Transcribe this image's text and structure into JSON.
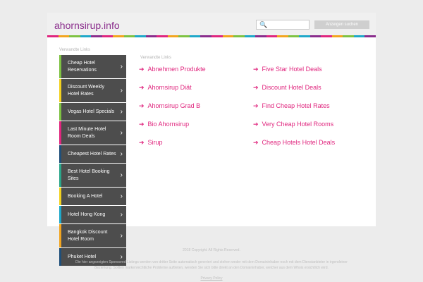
{
  "header": {
    "site_title": "ahornsirup.info",
    "search_placeholder": "",
    "search_button": "Anzeigen suchen"
  },
  "stripe_colors": [
    "#e0267e",
    "#f2a51f",
    "#7ec242",
    "#1fa8c9",
    "#8a2d8c",
    "#e0267e",
    "#f2a51f",
    "#7ec242",
    "#1fa8c9",
    "#8a2d8c",
    "#e0267e",
    "#f2a51f",
    "#7ec242",
    "#1fa8c9",
    "#8a2d8c",
    "#e0267e",
    "#f2a51f",
    "#7ec242",
    "#1fa8c9",
    "#8a2d8c",
    "#e0267e",
    "#f2a51f",
    "#7ec242",
    "#1fa8c9",
    "#8a2d8c",
    "#e0267e",
    "#f2a51f",
    "#7ec242",
    "#1fa8c9",
    "#8a2d8c"
  ],
  "sidebar": {
    "heading": "Verwandte Links",
    "items": [
      {
        "label": "Cheap Hotel Reservations",
        "accent": "#7ec242",
        "tall": true
      },
      {
        "label": "Discount Weekly Hotel Rates",
        "accent": "#f2d11f",
        "tall": true
      },
      {
        "label": "Vegas Hotel Specials",
        "accent": "#7ec242",
        "tall": false
      },
      {
        "label": "Last Minute Hotel Room Deals",
        "accent": "#e0267e",
        "tall": true
      },
      {
        "label": "Cheapest Hotel Rates",
        "accent": "#1f4f7a",
        "tall": false
      },
      {
        "label": "Best Hotel Booking Sites",
        "accent": "#2aa68a",
        "tall": true
      },
      {
        "label": "Booking A Hotel",
        "accent": "#f2d11f",
        "tall": false
      },
      {
        "label": "Hotel Hong Kong",
        "accent": "#1fa8c9",
        "tall": false
      },
      {
        "label": "Bangkok Discount Hotel Room",
        "accent": "#f2a51f",
        "tall": true
      },
      {
        "label": "Phuket Hotel",
        "accent": "#1f4f7a",
        "tall": false
      }
    ]
  },
  "main": {
    "heading": "Verwandte Links",
    "arrow": "➔",
    "left_links": [
      "Abnehmen Produkte",
      "Ahornsirup Diät",
      "Ahornsirup Grad B",
      "Bio Ahornsirup",
      "Sirup"
    ],
    "right_links": [
      "Five Star Hotel Deals",
      "Discount Hotel Deals",
      "Find Cheap Hotel Rates",
      "Very Cheap Hotel Rooms",
      "Cheap Hotels Hotel Deals"
    ]
  },
  "footer": {
    "copyright": "2018 Copyright. All Rights Reserved.",
    "disclaimer_line1": "Die hier angezeigten Sponsored Listings werden von dritter Seite automatisch generiert und stehen weder mit dem Domaininhaber noch mit dem Dienstanbieter in irgendeiner",
    "disclaimer_line2": "Beziehung. Sollten markenrechtliche Probleme auftreten, wenden Sie sich bitte direkt an den Domaininhaber, welcher aus dem Whois ersichtlich wird.",
    "privacy": "Privacy Policy"
  }
}
